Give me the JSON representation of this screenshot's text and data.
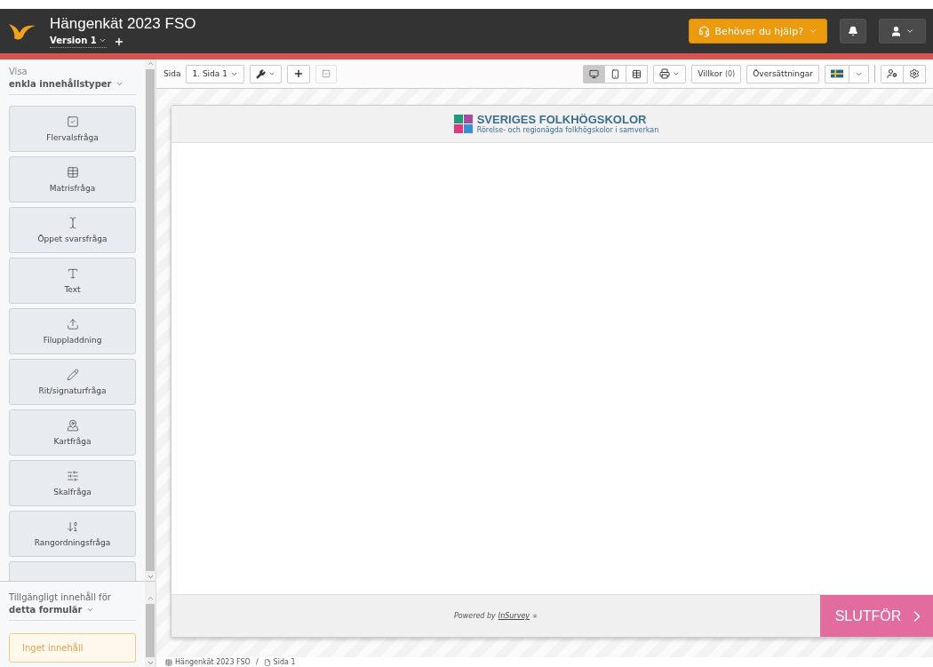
{
  "header": {
    "title": "Hängenkät 2023 FSO",
    "version": "Version 1",
    "help_button": "Behöver du hjälp?"
  },
  "sidebar": {
    "show_label": "Visa",
    "show_value": "enkla innehållstyper",
    "content_types": [
      {
        "label": "Flervalsfråga",
        "kind": "checkbox"
      },
      {
        "label": "Matrisfråga",
        "kind": "matrix"
      },
      {
        "label": "Öppet svarsfråga",
        "kind": "open"
      },
      {
        "label": "Text",
        "kind": "text"
      },
      {
        "label": "Filuppladdning",
        "kind": "upload"
      },
      {
        "label": "Rit/signaturfråga",
        "kind": "drawing"
      },
      {
        "label": "Kartfråga",
        "kind": "map"
      },
      {
        "label": "Skalfråga",
        "kind": "scale"
      },
      {
        "label": "Rangordningsfråga",
        "kind": "ranking"
      }
    ],
    "available_label": "Tillgängligt innehåll för",
    "available_value": "detta formulär",
    "empty_text": "Inget innehåll"
  },
  "toolbar": {
    "page_label": "Sida",
    "page_select": "1. Sida 1",
    "view_modes": [
      {
        "kind": "desktop",
        "selected": true
      },
      {
        "kind": "mobile",
        "selected": false
      },
      {
        "kind": "table",
        "selected": false
      }
    ],
    "conditions_button": "Villkor",
    "conditions_count": "(0)",
    "translations_button": "Översättningar"
  },
  "survey": {
    "logo_title": "SVERIGES FOLKHÖGSKOLOR",
    "logo_subtitle": "Rörelse- och regionägda folkhögskolor i samverkan",
    "powered_text": "Powered by",
    "powered_link": "InSurvey",
    "powered_mark": "®",
    "finish_button": "SLUTFÖR"
  },
  "breadcrumb": [
    "Hängenkät 2023 FSO",
    "/",
    "Sida 1"
  ]
}
